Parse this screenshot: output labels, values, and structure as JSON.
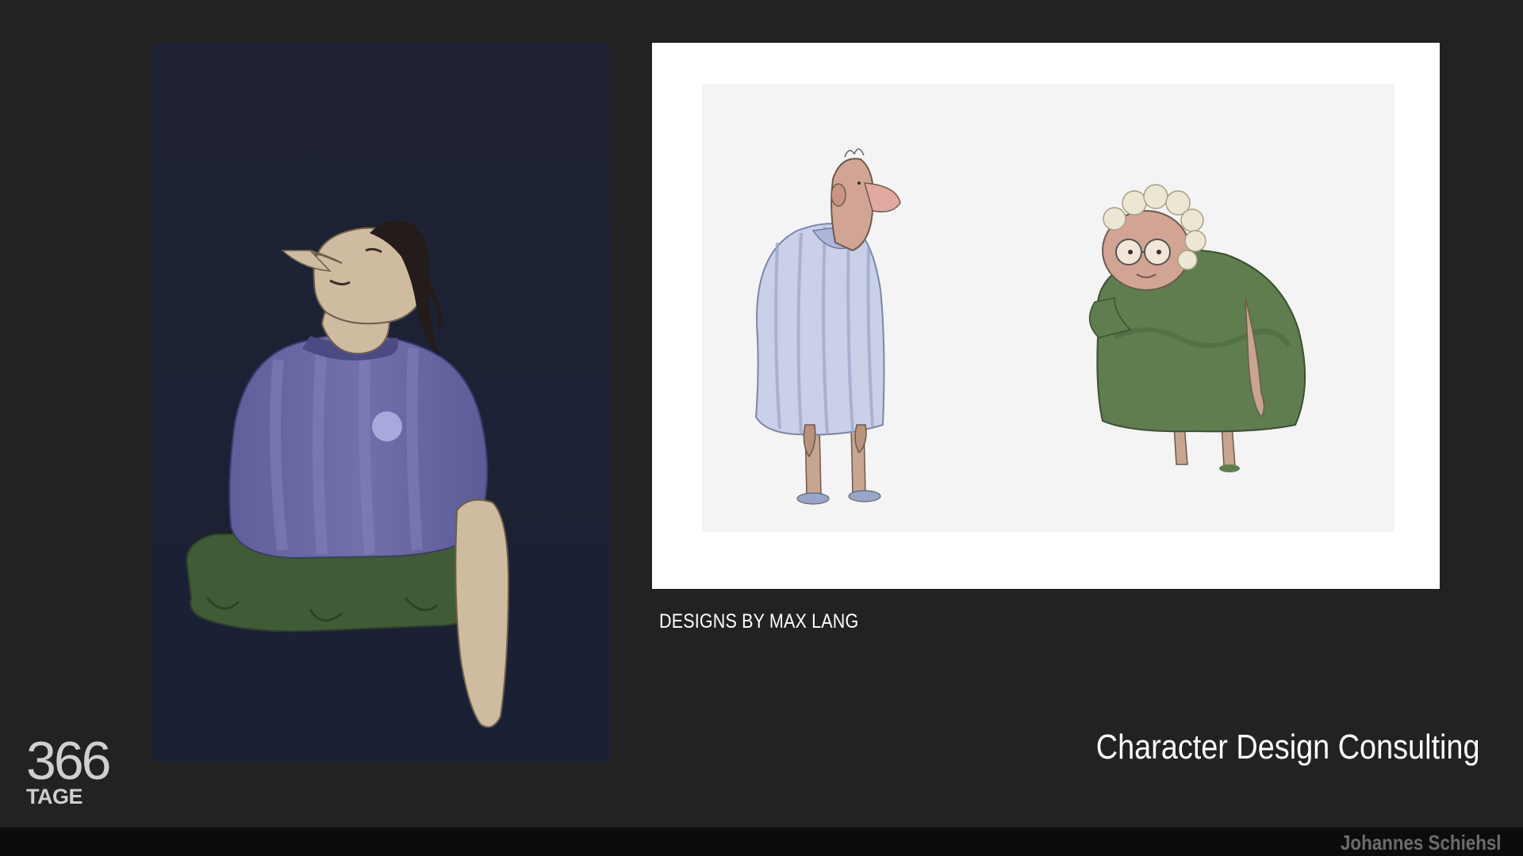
{
  "slide": {
    "caption": "DESIGNS BY MAX LANG",
    "title": "Character Design Consulting"
  },
  "logo": {
    "number": "366",
    "word": "TAGE"
  },
  "footer": {
    "author": "Johannes Schiehsl"
  },
  "artwork": {
    "left": "sketch-man-looking-up",
    "right": [
      "sketch-old-man-pajamas",
      "sketch-old-woman-green-dress"
    ]
  },
  "colors": {
    "background": "#222222",
    "left_panel": "#1c2235",
    "footer_bar": "#0c0c0c",
    "shirt": "#6a6aa6",
    "pants_green": "#3f5c36",
    "dress_green": "#5f7d4f",
    "pajama": "#c9d0e8",
    "skin": "#cfbba0"
  }
}
